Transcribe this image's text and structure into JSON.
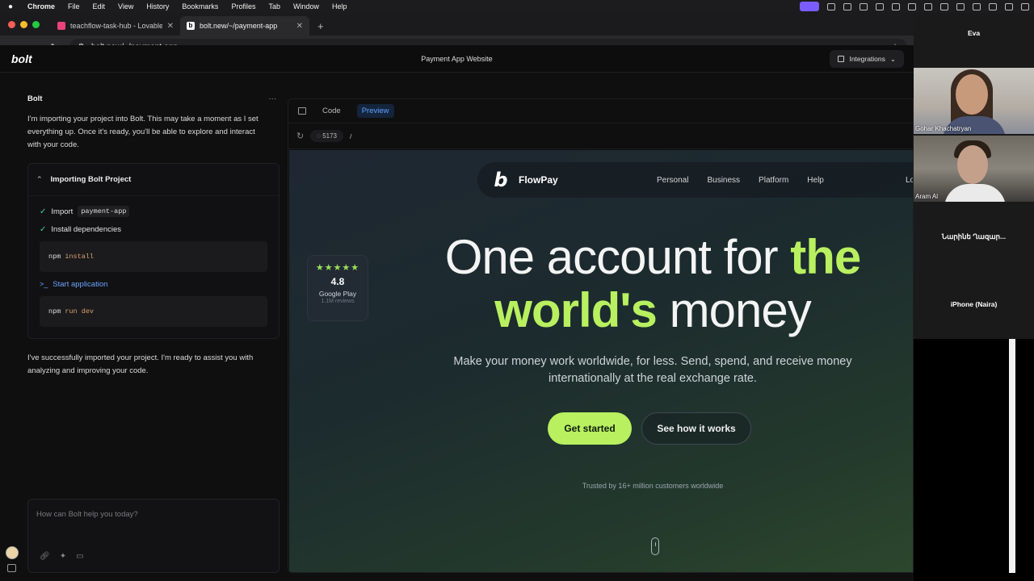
{
  "menubar": {
    "app_name": "Chrome",
    "items": [
      "File",
      "Edit",
      "View",
      "History",
      "Bookmarks",
      "Profiles",
      "Tab",
      "Window",
      "Help"
    ]
  },
  "browser": {
    "tabs": [
      {
        "label": "teachflow-task-hub - Lovable",
        "active": false,
        "favicon_color": "#e8437a"
      },
      {
        "label": "bolt.new/~/payment-app",
        "active": true,
        "favicon_color": "#ffffff"
      }
    ],
    "address": "bolt.new/~/payment-app"
  },
  "bolt": {
    "logo": "bolt",
    "project_title": "Payment App Website",
    "integrations_label": "Integrations",
    "chat": {
      "sender": "Bolt",
      "message1": "I'm importing your project into Bolt. This may take a moment as I set everything up. Once it's ready, you'll be able to explore and interact with your code.",
      "card_title": "Importing Bolt Project",
      "step1_prefix": "Import",
      "step1_code": "payment-app",
      "step2": "Install dependencies",
      "cmd1_bin": "npm",
      "cmd1_arg": "install",
      "step3": "Start application",
      "cmd2_bin": "npm",
      "cmd2_arg": "run dev",
      "message2": "I've successfully imported your project. I'm ready to assist you with analyzing and improving your code.",
      "input_placeholder": "How can Bolt help you today?"
    },
    "workbench": {
      "tab_code": "Code",
      "tab_preview": "Preview",
      "port": "5173",
      "path": "/"
    }
  },
  "site": {
    "brand": "FlowPay",
    "logo_letter": "b",
    "nav_links": [
      "Personal",
      "Business",
      "Platform",
      "Help"
    ],
    "nav_login": "Lo",
    "rating": {
      "stars": "★★★★★",
      "score": "4.8",
      "store": "Google Play",
      "reviews": "1.1M reviews"
    },
    "hero": {
      "line1_plain": "One account for ",
      "line1_accent": "the",
      "line2_accent": "world's",
      "line2_plain": " money",
      "subtitle": "Make your money work worldwide, for less. Send, spend, and receive money internationally at the real exchange rate.",
      "cta_primary": "Get started",
      "cta_secondary": "See how it works",
      "trusted": "Trusted by 16+ million customers worldwide"
    },
    "accent_color": "#b8f060"
  },
  "call": {
    "top_name": "Eva",
    "participants": [
      {
        "name": "Gohar Khachatryan"
      },
      {
        "name": "Aram Al"
      }
    ],
    "name_only_1": "Նարինե Ղազար...",
    "name_only_2": "iPhone (Naira)"
  }
}
